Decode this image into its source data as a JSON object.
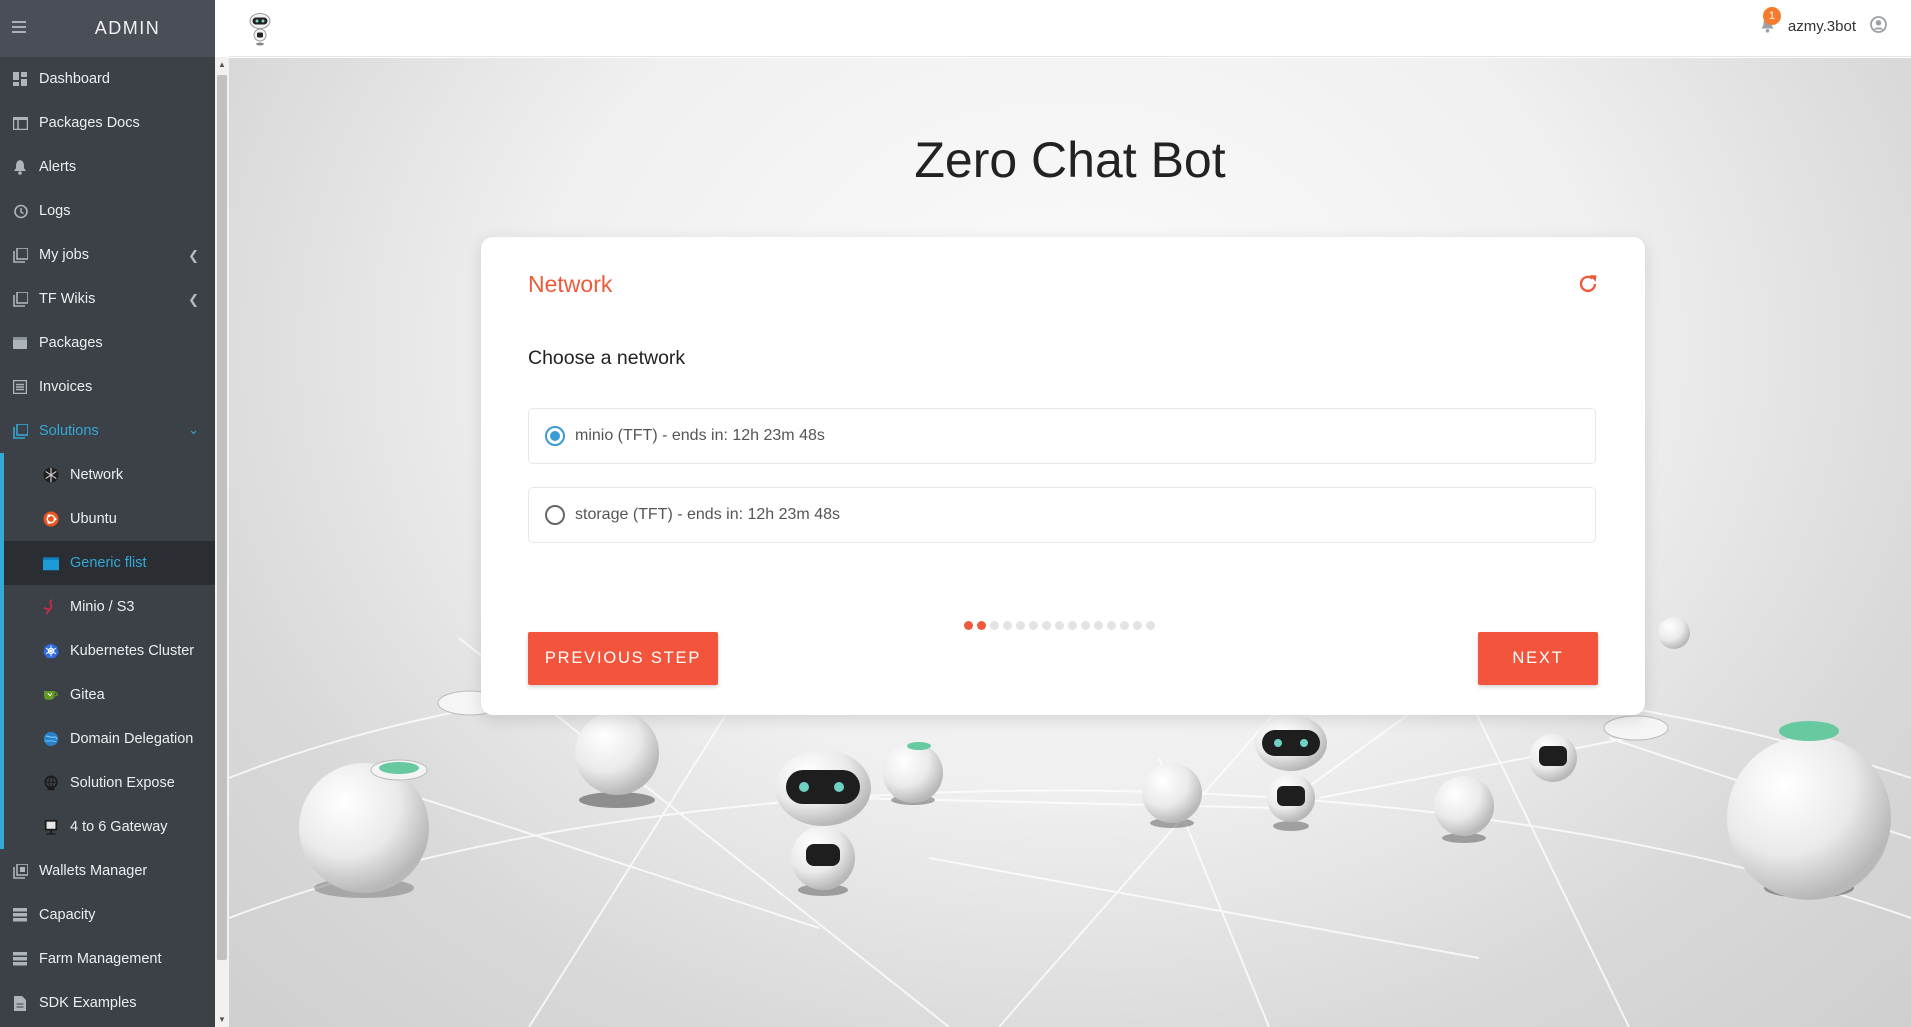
{
  "sidebar": {
    "title": "ADMIN",
    "items": [
      {
        "label": "Dashboard"
      },
      {
        "label": "Packages Docs"
      },
      {
        "label": "Alerts"
      },
      {
        "label": "Logs"
      },
      {
        "label": "My jobs"
      },
      {
        "label": "TF Wikis"
      },
      {
        "label": "Packages"
      },
      {
        "label": "Invoices"
      },
      {
        "label": "Solutions"
      }
    ],
    "solutions": [
      {
        "label": "Network"
      },
      {
        "label": "Ubuntu"
      },
      {
        "label": "Generic flist"
      },
      {
        "label": "Minio / S3"
      },
      {
        "label": "Kubernetes Cluster"
      },
      {
        "label": "Gitea"
      },
      {
        "label": "Domain Delegation"
      },
      {
        "label": "Solution Expose"
      },
      {
        "label": "4 to 6 Gateway"
      }
    ],
    "bottom_items": [
      {
        "label": "Wallets Manager"
      },
      {
        "label": "Capacity"
      },
      {
        "label": "Farm Management"
      },
      {
        "label": "SDK Examples"
      }
    ]
  },
  "topbar": {
    "notification_count": "1",
    "username": "azmy.3bot"
  },
  "main": {
    "title": "Zero Chat Bot",
    "card": {
      "title": "Network",
      "question": "Choose a network",
      "options": [
        {
          "label": "minio (TFT) - ends in: 12h 23m 48s",
          "selected": true
        },
        {
          "label": "storage (TFT) - ends in: 12h 23m 48s",
          "selected": false
        }
      ],
      "progress": {
        "completed": 2,
        "total": 15
      },
      "prev_label": "PREVIOUS STEP",
      "next_label": "NEXT"
    }
  },
  "colors": {
    "accent": "#ee5a3c",
    "sidebar_bg": "#3c4047",
    "active_blue": "#33a9d8",
    "radio_blue": "#3b9bd6"
  }
}
